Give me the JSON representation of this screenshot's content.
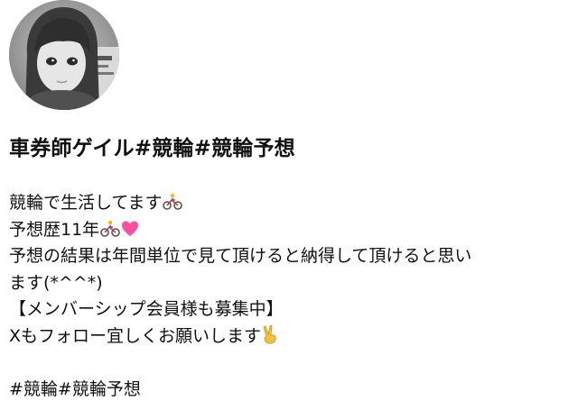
{
  "profile": {
    "avatar": {
      "icon": "user-avatar-photo"
    },
    "display_name": "車券師ゲイル#競輪#競輪予想",
    "bio": {
      "line1": "競輪で生活してます",
      "line2": "予想歴11年",
      "line3": "予想の結果は年間単位で見て頂けると納得して頂けると思い",
      "line4": "ます(*^^*)",
      "line5": "【メンバーシップ会員様も募集中】",
      "line6": "Xもフォロー宜しくお願いします",
      "line8": "#競輪#競輪予想"
    },
    "emoji": {
      "cyclist": "bicyclist-emoji",
      "heart": "pink-heart-emoji",
      "victory": "victory-hand-emoji"
    }
  }
}
